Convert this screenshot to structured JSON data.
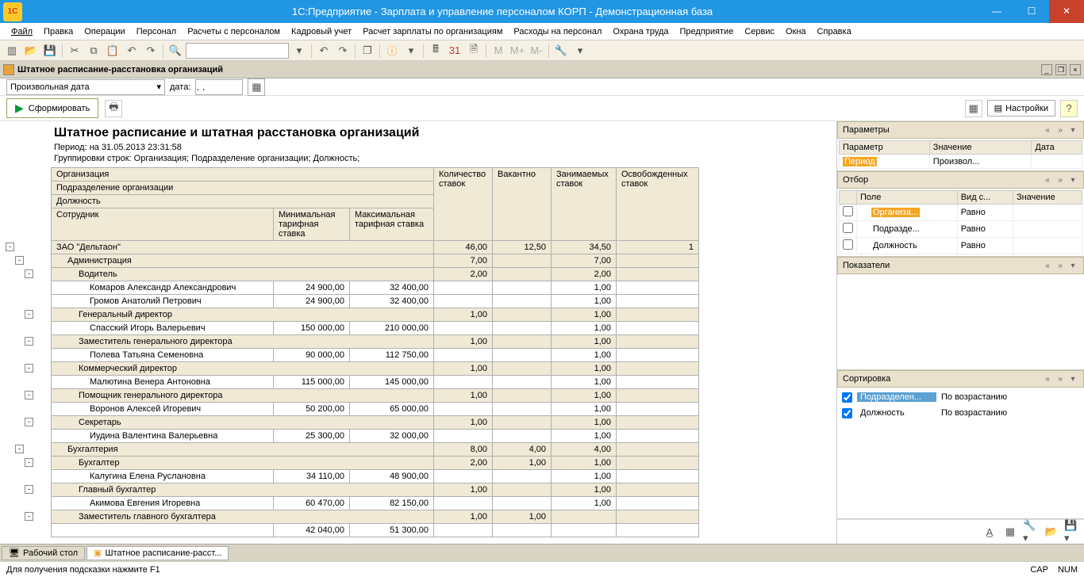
{
  "window": {
    "title": "1С:Предприятие - Зарплата и управление персоналом КОРП - Демонстрационная база"
  },
  "menu": [
    "Файл",
    "Правка",
    "Операции",
    "Персонал",
    "Расчеты с персоналом",
    "Кадровый учет",
    "Расчет зарплаты по организациям",
    "Расходы на персонал",
    "Охрана труда",
    "Предприятие",
    "Сервис",
    "Окна",
    "Справка"
  ],
  "doc_title": "Штатное расписание-расстановка организаций",
  "date_row": {
    "combo": "Произвольная дата",
    "label": "дата:",
    "value": ". ."
  },
  "buttons": {
    "form": "Сформировать",
    "settings": "Настройки"
  },
  "report": {
    "title": "Штатное расписание и штатная расстановка организаций",
    "period": "Период: на 31.05.2013 23:31:58",
    "groupings": "Группировки строк: Организация; Подразделение организации; Должность;",
    "head_left": [
      "Организация",
      "Подразделение организации",
      "Должность",
      "Сотрудник"
    ],
    "head_min": "Минимальная тарифная ставка",
    "head_max": "Максимальная тарифная ставка",
    "head_cols": [
      "Количество ставок",
      "Вакантно",
      "Занимаемых ставок",
      "Освобожденных ставок"
    ],
    "rows": [
      {
        "lvl": 0,
        "tgl": "-",
        "name": "ЗАО \"Дельтаон\"",
        "min": "",
        "max": "",
        "c1": "46,00",
        "c2": "12,50",
        "c3": "34,50",
        "c4": "1"
      },
      {
        "lvl": 1,
        "tgl": "-",
        "name": "Администрация",
        "min": "",
        "max": "",
        "c1": "7,00",
        "c2": "",
        "c3": "7,00",
        "c4": ""
      },
      {
        "lvl": 2,
        "tgl": "-",
        "name": "Водитель",
        "min": "",
        "max": "",
        "c1": "2,00",
        "c2": "",
        "c3": "2,00",
        "c4": ""
      },
      {
        "lvl": 3,
        "tgl": "",
        "name": "Комаров Александр Александрович",
        "min": "24 900,00",
        "max": "32 400,00",
        "c1": "",
        "c2": "",
        "c3": "1,00",
        "c4": ""
      },
      {
        "lvl": 3,
        "tgl": "",
        "name": "Громов Анатолий Петрович",
        "min": "24 900,00",
        "max": "32 400,00",
        "c1": "",
        "c2": "",
        "c3": "1,00",
        "c4": ""
      },
      {
        "lvl": 2,
        "tgl": "-",
        "name": "Генеральный директор",
        "min": "",
        "max": "",
        "c1": "1,00",
        "c2": "",
        "c3": "1,00",
        "c4": ""
      },
      {
        "lvl": 3,
        "tgl": "",
        "name": "Спасский Игорь Валерьевич",
        "min": "150 000,00",
        "max": "210 000,00",
        "c1": "",
        "c2": "",
        "c3": "1,00",
        "c4": ""
      },
      {
        "lvl": 2,
        "tgl": "-",
        "name": "Заместитель генерального директора",
        "min": "",
        "max": "",
        "c1": "1,00",
        "c2": "",
        "c3": "1,00",
        "c4": ""
      },
      {
        "lvl": 3,
        "tgl": "",
        "name": "Полева Татьяна Семеновна",
        "min": "90 000,00",
        "max": "112 750,00",
        "c1": "",
        "c2": "",
        "c3": "1,00",
        "c4": ""
      },
      {
        "lvl": 2,
        "tgl": "-",
        "name": "Коммерческий директор",
        "min": "",
        "max": "",
        "c1": "1,00",
        "c2": "",
        "c3": "1,00",
        "c4": ""
      },
      {
        "lvl": 3,
        "tgl": "",
        "name": "Малютина Венера Антоновна",
        "min": "115 000,00",
        "max": "145 000,00",
        "c1": "",
        "c2": "",
        "c3": "1,00",
        "c4": ""
      },
      {
        "lvl": 2,
        "tgl": "-",
        "name": "Помощник генерального директора",
        "min": "",
        "max": "",
        "c1": "1,00",
        "c2": "",
        "c3": "1,00",
        "c4": ""
      },
      {
        "lvl": 3,
        "tgl": "",
        "name": "Воронов Алексей Игоревич",
        "min": "50 200,00",
        "max": "65 000,00",
        "c1": "",
        "c2": "",
        "c3": "1,00",
        "c4": ""
      },
      {
        "lvl": 2,
        "tgl": "-",
        "name": "Секретарь",
        "min": "",
        "max": "",
        "c1": "1,00",
        "c2": "",
        "c3": "1,00",
        "c4": ""
      },
      {
        "lvl": 3,
        "tgl": "",
        "name": "Иудина Валентина Валерьевна",
        "min": "25 300,00",
        "max": "32 000,00",
        "c1": "",
        "c2": "",
        "c3": "1,00",
        "c4": ""
      },
      {
        "lvl": 1,
        "tgl": "-",
        "name": "Бухгалтерия",
        "min": "",
        "max": "",
        "c1": "8,00",
        "c2": "4,00",
        "c3": "4,00",
        "c4": ""
      },
      {
        "lvl": 2,
        "tgl": "-",
        "name": "Бухгалтер",
        "min": "",
        "max": "",
        "c1": "2,00",
        "c2": "1,00",
        "c3": "1,00",
        "c4": ""
      },
      {
        "lvl": 3,
        "tgl": "",
        "name": "Калугина Елена Руслановна",
        "min": "34 110,00",
        "max": "48 900,00",
        "c1": "",
        "c2": "",
        "c3": "1,00",
        "c4": ""
      },
      {
        "lvl": 2,
        "tgl": "-",
        "name": "Главный бухгалтер",
        "min": "",
        "max": "",
        "c1": "1,00",
        "c2": "",
        "c3": "1,00",
        "c4": ""
      },
      {
        "lvl": 3,
        "tgl": "",
        "name": "Акимова Евгения Игоревна",
        "min": "60 470,00",
        "max": "82 150,00",
        "c1": "",
        "c2": "",
        "c3": "1,00",
        "c4": ""
      },
      {
        "lvl": 2,
        "tgl": "-",
        "name": "Заместитель главного бухгалтера",
        "min": "",
        "max": "",
        "c1": "1,00",
        "c2": "1,00",
        "c3": "",
        "c4": ""
      },
      {
        "lvl": 3,
        "tgl": "",
        "name": "",
        "min": "42 040,00",
        "max": "51 300,00",
        "c1": "",
        "c2": "",
        "c3": "",
        "c4": ""
      }
    ]
  },
  "side": {
    "params": {
      "title": "Параметры",
      "cols": [
        "Параметр",
        "Значение",
        "Дата"
      ],
      "rows": [
        {
          "p": "Период",
          "v": "Произвол...",
          "d": ""
        }
      ]
    },
    "filter": {
      "title": "Отбор",
      "cols": [
        "",
        "Поле",
        "Вид с...",
        "Значение"
      ],
      "rows": [
        {
          "f": "Организа...",
          "c": "Равно"
        },
        {
          "f": "Подразде...",
          "c": "Равно"
        },
        {
          "f": "Должность",
          "c": "Равно"
        }
      ]
    },
    "indic": {
      "title": "Показатели"
    },
    "sort": {
      "title": "Сортировка",
      "rows": [
        {
          "f": "Подразделен...",
          "o": "По возрастанию",
          "sel": true
        },
        {
          "f": "Должность",
          "o": "По возрастанию",
          "sel": false
        }
      ]
    }
  },
  "tabs": {
    "desk": "Рабочий стол",
    "doc": "Штатное расписание-расст..."
  },
  "status": {
    "hint": "Для получения подсказки нажмите F1",
    "cap": "CAP",
    "num": "NUM"
  }
}
